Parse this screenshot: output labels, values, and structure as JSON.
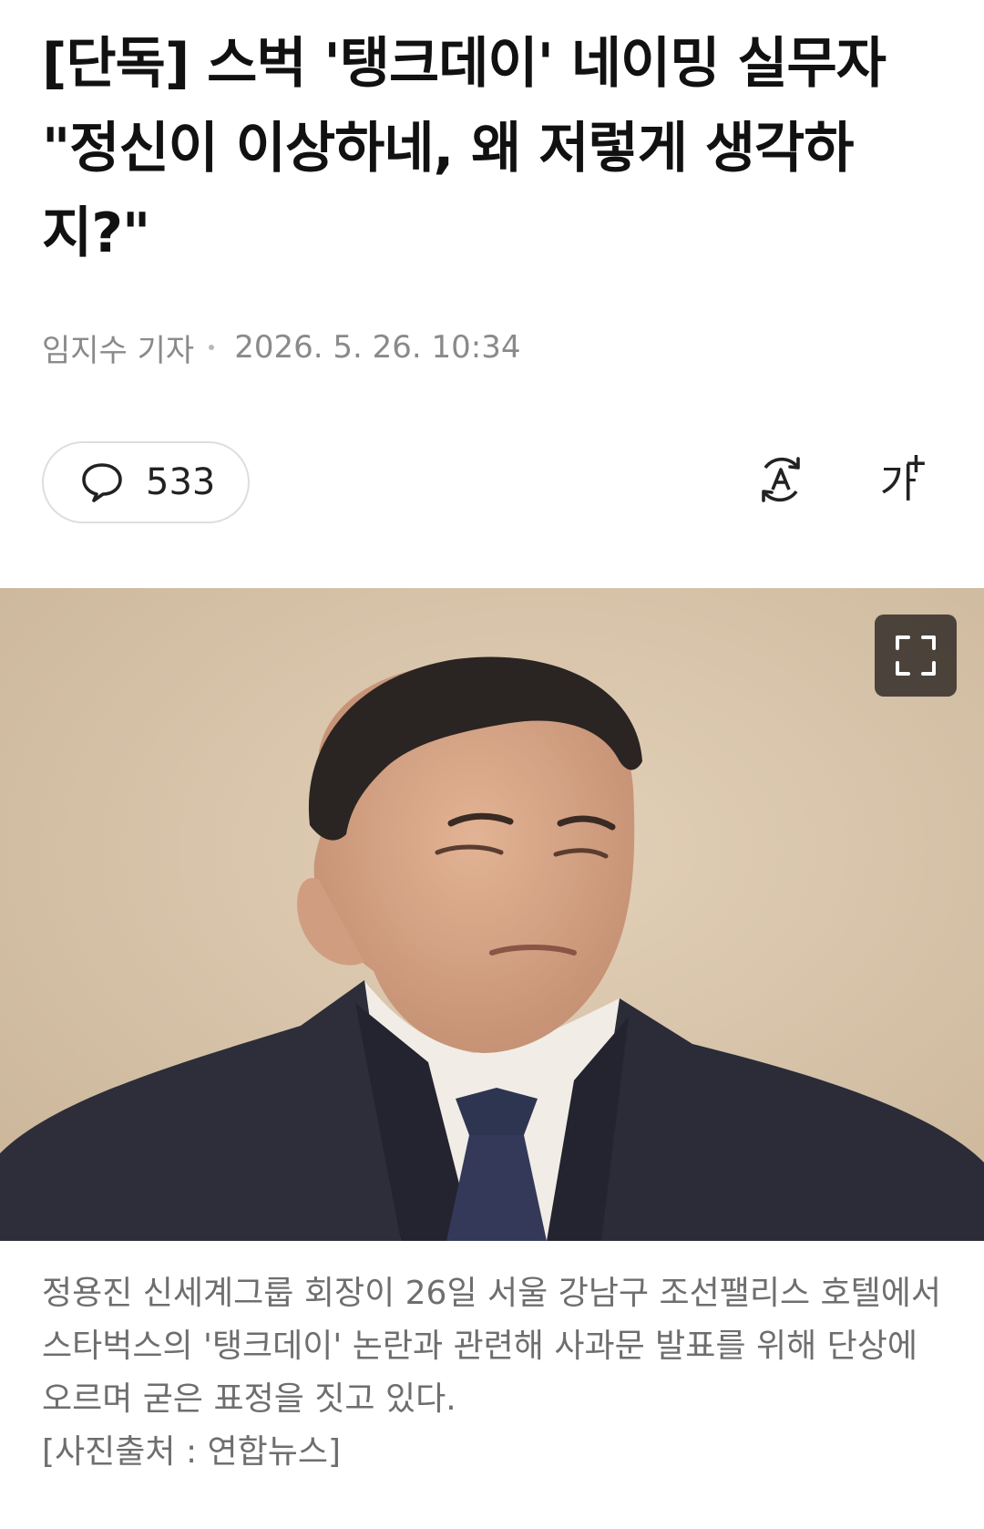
{
  "article": {
    "headline": "[단독] 스벅 '탱크데이' 네이밍 실무자 \"정신이 이상하네, 왜 저렇게 생각하지?\"",
    "reporter": "임지수 기자",
    "datetime": "2026. 5. 26. 10:34"
  },
  "toolbar": {
    "comment_icon": "comment-bubble-icon",
    "comment_count": "533",
    "translate_icon": "translate-icon",
    "font_size_icon": "font-size-icon",
    "font_size_glyph": "가",
    "font_size_plus": "+"
  },
  "photo": {
    "expand_icon": "expand-icon",
    "caption": "정용진 신세계그룹 회장이 26일 서울 강남구 조선팰리스 호텔에서 스타벅스의 '탱크데이' 논란과 관련해 사과문 발표를 위해 단상에 오르며 굳은 표정을 짓고 있다.",
    "credit": "[사진출처 : 연합뉴스]"
  },
  "colors": {
    "text": "#111111",
    "meta": "#8a8a8a",
    "caption": "#6e6e6e",
    "pill_border": "#dedede",
    "photo_bg": "#d6c2a8"
  }
}
